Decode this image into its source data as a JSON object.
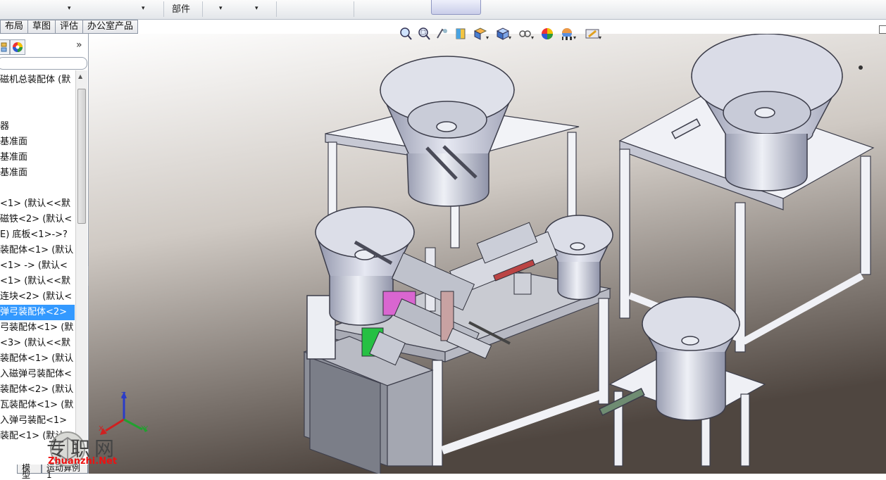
{
  "toolbar": {
    "parts_label": "部件",
    "dropdown_arrows": [
      "▾",
      "▾",
      "▾",
      "▾"
    ]
  },
  "command_tabs": [
    "布局",
    "草图",
    "评估",
    "办公室产品"
  ],
  "feature_manager": {
    "expand_label": "»",
    "tree_items": [
      {
        "label": "磁机总装配体 (默",
        "selected": false
      },
      {
        "label": "",
        "selected": false
      },
      {
        "label": "",
        "selected": false
      },
      {
        "label": "器",
        "selected": false
      },
      {
        "label": "基准面",
        "selected": false
      },
      {
        "label": "基准面",
        "selected": false
      },
      {
        "label": "基准面",
        "selected": false
      },
      {
        "label": "",
        "selected": false
      },
      {
        "label": "<1> (默认<<默",
        "selected": false
      },
      {
        "label": "磁铁<2> (默认<",
        "selected": false
      },
      {
        "label": "E) 底板<1>->?",
        "selected": false
      },
      {
        "label": "装配体<1> (默认",
        "selected": false
      },
      {
        "label": "<1> -> (默认<",
        "selected": false
      },
      {
        "label": "<1> (默认<<默",
        "selected": false
      },
      {
        "label": "连块<2> (默认<",
        "selected": false
      },
      {
        "label": "弹弓装配体<2>",
        "selected": true
      },
      {
        "label": "弓装配体<1> (默",
        "selected": false
      },
      {
        "label": "<3> (默认<<默",
        "selected": false
      },
      {
        "label": "装配体<1> (默认",
        "selected": false
      },
      {
        "label": "入磁弹弓装配体<",
        "selected": false
      },
      {
        "label": "装配体<2> (默认",
        "selected": false
      },
      {
        "label": "瓦装配体<1> (默",
        "selected": false
      },
      {
        "label": "入弹弓装配<1>",
        "selected": false
      },
      {
        "label": "装配<1> (默认",
        "selected": false
      }
    ]
  },
  "bottom_tabs": [
    "模型",
    "运动算例 1"
  ],
  "triad_axes": [
    "Z",
    "X",
    "Y"
  ],
  "watermark": {
    "text": "专职网",
    "url": "Zhuanzhi.Net"
  },
  "colors": {
    "selection": "#3399ff",
    "viewport_top": "#ffffff",
    "viewport_bottom": "#5a4f48",
    "accent_green": "#26c043",
    "accent_pink": "#d966d0"
  }
}
